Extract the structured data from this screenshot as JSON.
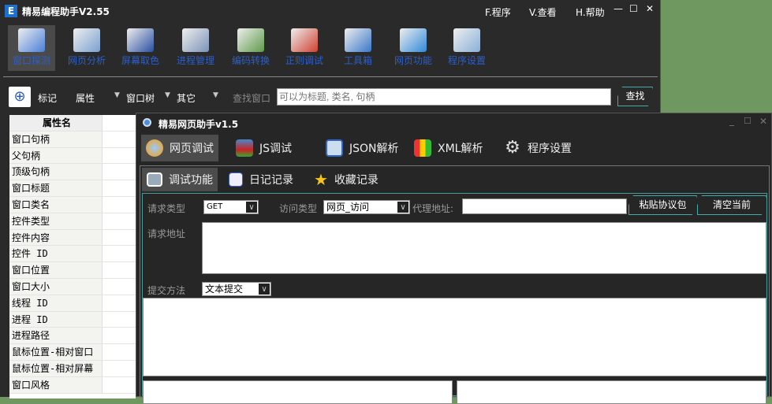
{
  "main": {
    "title": "精易编程助手V2.55",
    "menus": [
      "F.程序",
      "V.查看",
      "H.帮助"
    ],
    "tools": [
      {
        "label": "窗口探测",
        "color": "#4a7fd8"
      },
      {
        "label": "网页分析",
        "color": "#7aa0d0"
      },
      {
        "label": "屏幕取色",
        "color": "#2a4fa0"
      },
      {
        "label": "进程管理",
        "color": "#7b93b8"
      },
      {
        "label": "编码转换",
        "color": "#5e9a4a"
      },
      {
        "label": "正则调试",
        "color": "#d04030"
      },
      {
        "label": "工具箱",
        "color": "#3a78c8"
      },
      {
        "label": "网页功能",
        "color": "#2f8ad8"
      },
      {
        "label": "程序设置",
        "color": "#8ab0d8"
      }
    ],
    "search": {
      "mark": "标记",
      "attr": "属性",
      "tree": "窗口树",
      "other": "其它",
      "find_label": "查找窗口",
      "placeholder": "可以为标题, 类名, 句柄",
      "find_button": "查找"
    },
    "props": {
      "header": "属性名",
      "rows": [
        "窗口句柄",
        "父句柄",
        "顶级句柄",
        "窗口标题",
        "窗口类名",
        "控件类型",
        "控件内容",
        "控件 ID",
        "窗口位置",
        "窗口大小",
        "线程 ID",
        "进程 ID",
        "进程路径",
        "鼠标位置-相对窗口",
        "鼠标位置-相对屏幕",
        "窗口风格"
      ]
    }
  },
  "web": {
    "title": "精易网页助手v1.5",
    "tabs": [
      "网页调试",
      "JS调试",
      "JSON解析",
      "XML解析",
      "程序设置"
    ],
    "subtabs": [
      "调试功能",
      "日记记录",
      "收藏记录"
    ],
    "form": {
      "req_type_label": "请求类型",
      "req_type": "GET",
      "visit_type_label": "访问类型",
      "visit_type": "网页_访问",
      "proxy_label": "代理地址:",
      "proxy": "",
      "paste_button": "粘贴协议包",
      "clear_button": "清空当前",
      "url_label": "请求地址",
      "url": "",
      "submit_label": "提交方法",
      "submit": "文本提交"
    }
  }
}
